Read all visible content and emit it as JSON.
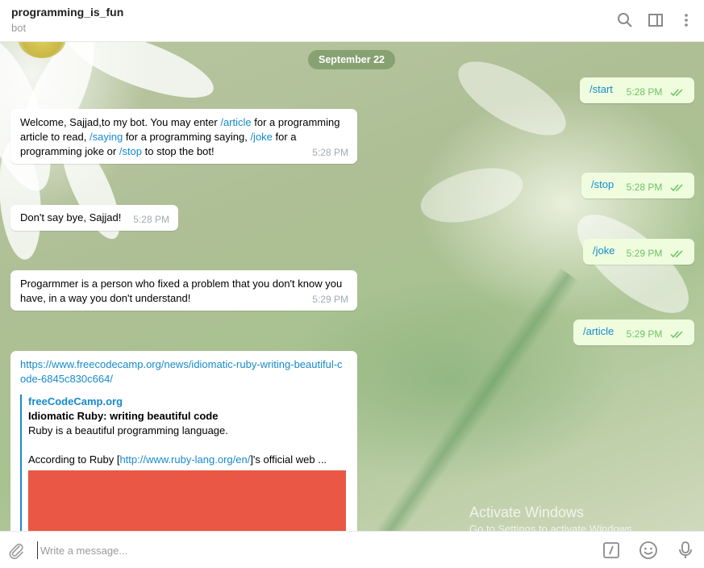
{
  "header": {
    "title": "programming_is_fun",
    "subtitle": "bot",
    "icons": [
      "search-icon",
      "sidebar-toggle-icon",
      "more-vertical-icon"
    ]
  },
  "chat": {
    "date_separator": "September 22",
    "messages": [
      {
        "id": "m1",
        "direction": "out",
        "text": "/start",
        "time": "5:28 PM",
        "status": "read"
      },
      {
        "id": "m2",
        "direction": "in",
        "parts": [
          "Welcome, Sajjad,to my bot. You may enter ",
          "/article",
          " for a programming article to read, ",
          "/saying",
          " for a programming saying, ",
          "/joke",
          " for a programming joke or ",
          "/stop",
          " to stop the bot!"
        ],
        "time": "5:28 PM"
      },
      {
        "id": "m3",
        "direction": "out",
        "text": "/stop",
        "time": "5:28 PM",
        "status": "read"
      },
      {
        "id": "m4",
        "direction": "in",
        "text": "Don't say bye, Sajjad!",
        "time": "5:28 PM"
      },
      {
        "id": "m5",
        "direction": "out",
        "text": "/joke",
        "time": "5:29 PM",
        "status": "read"
      },
      {
        "id": "m6",
        "direction": "in",
        "text": "Progarmmer is a person who fixed a problem that you don't know you have, in a way you don't understand!",
        "time": "5:29 PM"
      },
      {
        "id": "m7",
        "direction": "out",
        "text": "/article",
        "time": "5:29 PM",
        "status": "read"
      },
      {
        "id": "m8",
        "direction": "in",
        "url": "https://www.freecodecamp.org/news/idiomatic-ruby-writing-beautiful-code-6845c830c664/",
        "preview": {
          "site": "freeCodeCamp.org",
          "title": "Idiomatic Ruby: writing beautiful code",
          "line1": "Ruby is a beautiful programming language.",
          "line2_before": "According to Ruby [",
          "line2_link": "http://www.ruby-lang.org/en/",
          "line2_after": "]'s official web ...",
          "image_color": "#ea5845"
        }
      }
    ]
  },
  "composer": {
    "placeholder": "Write a message...",
    "icons": [
      "attach-icon",
      "commands-icon",
      "emoji-icon",
      "microphone-icon"
    ]
  },
  "watermark": {
    "line1": "Activate Windows",
    "line2": "Go to Settings to activate Windows."
  },
  "colors": {
    "link": "#168acd",
    "outgoing_bubble": "#effdde",
    "read_check": "#6cc264",
    "date_pill": "#7f9a68"
  }
}
